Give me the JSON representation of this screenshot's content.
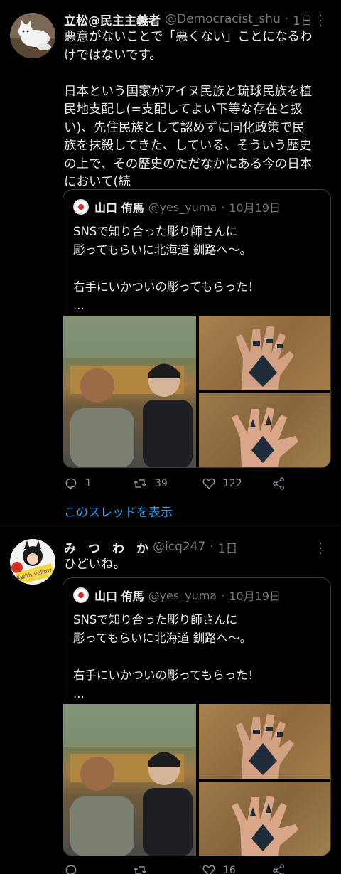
{
  "tweets": [
    {
      "author_name": "立松@民主主義者",
      "handle": "@Democracist_shu",
      "dot": "·",
      "time": "1日",
      "text": "悪意がないことで「悪くない」ことになるわ\nけではないです。\n\n日本という国家がアイヌ民族と琉球民族を植\n民地支配し(=支配してよい下等な存在と扱\nい)、先住民族として認めずに同化政策で民\n族を抹殺してきた、している、そういう歴史\nの上で、その歴史のただなかにある今の日本\nにおいて(続",
      "quote": {
        "name": "山口 侑馬",
        "handle": "@yes_yuma",
        "dot": "·",
        "date": "10月19日",
        "text": "SNSで知り合った彫り師さんに\n彫ってもらいに北海道 釧路へ〜。\n\n右手にいかついの彫ってもらった！\n..."
      },
      "actions": {
        "reply": "1",
        "retweet": "39",
        "like": "122"
      },
      "thread_link": "このスレッドを表示",
      "avatar_icon": "cat-avatar-icon"
    },
    {
      "author_name": "み　つ　わ　か",
      "handle": "@icq247",
      "dot": "·",
      "time": "1日",
      "text": "ひどいね。",
      "avatar_badge": "#with yellow",
      "quote": {
        "name": "山口 侑馬",
        "handle": "@yes_yuma",
        "dot": "·",
        "date": "10月19日",
        "text": "SNSで知り合った彫り師さんに\n彫ってもらいに北海道 釧路へ〜。\n\n右手にいかついの彫ってもらった！\n..."
      },
      "actions": {
        "reply": "",
        "retweet": "",
        "like": "16"
      }
    }
  ],
  "colors": {
    "background": "#000000",
    "link": "#1d9bf0",
    "secondary": "#71767b",
    "border": "#2f3336"
  }
}
